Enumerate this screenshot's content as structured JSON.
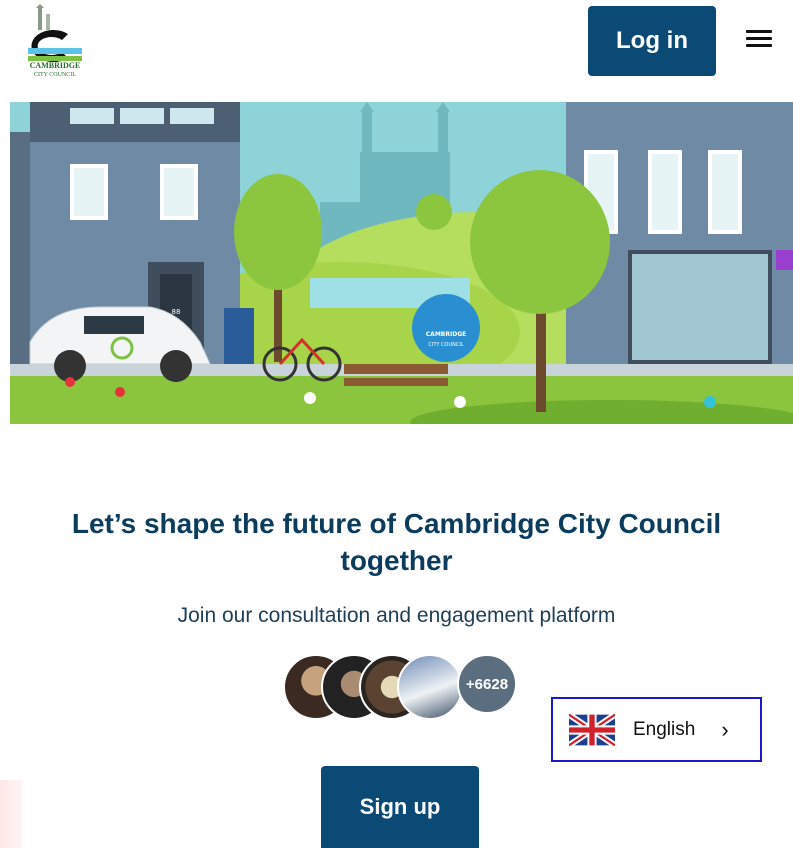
{
  "header": {
    "logo_text_line1": "CAMBRIDGE",
    "logo_text_line2": "CITY COUNCIL",
    "login_label": "Log in",
    "menu_icon": "hamburger-icon"
  },
  "hero": {
    "sign_text_1": "CAMBRIDGE",
    "sign_text_2": "CITY COUNCIL",
    "door_number": "88"
  },
  "main": {
    "headline": "Let’s shape the future of Cambridge City Council together",
    "subline": "Join our consultation and engagement platform",
    "member_count": "+6628",
    "signup_label": "Sign up"
  },
  "language": {
    "label": "English",
    "flag_icon": "uk-flag-icon",
    "chevron": "›"
  },
  "colors": {
    "primary": "#0b4a75",
    "heading": "#0b3c5d",
    "language_border": "#1a1acc"
  }
}
